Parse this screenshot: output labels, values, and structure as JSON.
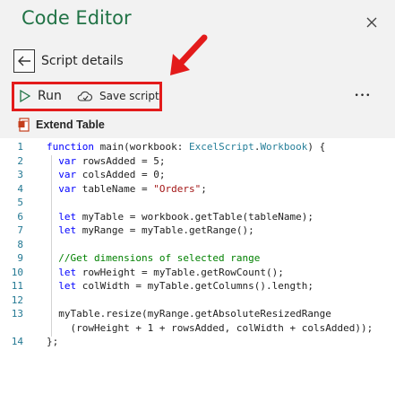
{
  "header": {
    "title": "Code Editor",
    "close_icon": "close-icon",
    "subtitle": "Script details",
    "back_icon": "back-arrow-icon"
  },
  "toolbar": {
    "run_label": "Run",
    "save_label": "Save script",
    "more_label": "•••"
  },
  "script": {
    "name": "Extend Table"
  },
  "colors": {
    "title": "#217346",
    "highlight": "#e31b1b",
    "keyword": "#0000ff",
    "type": "#267f99",
    "string": "#a31515",
    "comment": "#008000",
    "line_number": "#237893"
  },
  "code": {
    "numbers": [
      "1",
      "2",
      "3",
      "4",
      "5",
      "6",
      "7",
      "8",
      "9",
      "10",
      "11",
      "12",
      "13",
      "",
      "14"
    ],
    "l1": {
      "a": "function",
      "b": " main(workbook: ",
      "c": "ExcelScript",
      "d": ".",
      "e": "Workbook",
      "f": ") {"
    },
    "l2": {
      "a": "  var",
      "b": " rowsAdded = 5;"
    },
    "l3": {
      "a": "  var",
      "b": " colsAdded = 0;"
    },
    "l4": {
      "a": "  var",
      "b": " tableName = ",
      "c": "\"Orders\"",
      "d": ";"
    },
    "l6": {
      "a": "  let",
      "b": " myTable = workbook.getTable(tableName);"
    },
    "l7": {
      "a": "  let",
      "b": " myRange = myTable.getRange();"
    },
    "l9": {
      "a": "  //Get dimensions of selected range"
    },
    "l10": {
      "a": "  let",
      "b": " rowHeight = myTable.getRowCount();"
    },
    "l11": {
      "a": "  let",
      "b": " colWidth = myTable.getColumns().length;"
    },
    "l13": {
      "a": "  myTable.resize(myRange.getAbsoluteResizedRange"
    },
    "l13b": {
      "a": "    (rowHeight + 1 + rowsAdded, colWidth + colsAdded));"
    },
    "l14": {
      "a": "};"
    }
  }
}
